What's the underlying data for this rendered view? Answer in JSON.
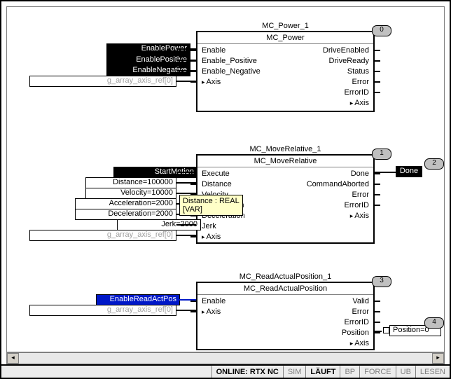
{
  "blocks": {
    "power": {
      "id_tab": "0",
      "instance": "MC_Power_1",
      "type": "MC_Power",
      "left_pins": [
        "Enable",
        "Enable_Positive",
        "Enable_Negative",
        "Axis"
      ],
      "right_pins": [
        "DriveEnabled",
        "DriveReady",
        "Status",
        "Error",
        "ErrorID"
      ],
      "right_axis": "Axis",
      "inputs": [
        {
          "name": "enable-power",
          "text": "EnablePower",
          "inverted": true
        },
        {
          "name": "enable-positive",
          "text": "EnablePositive",
          "inverted": true
        },
        {
          "name": "enable-negative",
          "text": "EnableNegative",
          "inverted": true
        },
        {
          "name": "axis-ref",
          "text": "g_array_axis_ref[0]",
          "dim": true
        }
      ]
    },
    "move": {
      "id_tab": "1",
      "instance": "MC_MoveRelative_1",
      "type": "MC_MoveRelative",
      "left_pins": [
        "Execute",
        "Distance",
        "Velocity",
        "Acceleration",
        "Deceleration",
        "Jerk",
        "Axis"
      ],
      "right_pins": [
        "Done",
        "CommandAborted",
        "Error",
        "ErrorID"
      ],
      "right_axis": "Axis",
      "inputs": [
        {
          "name": "start-motion",
          "text": "StartMotion",
          "inverted": true
        },
        {
          "name": "distance",
          "text": "Distance=100000"
        },
        {
          "name": "velocity",
          "text": "Velocity=10000"
        },
        {
          "name": "acceleration",
          "text": "Acceleration=2000"
        },
        {
          "name": "deceleration",
          "text": "Deceleration=2000"
        },
        {
          "name": "jerk",
          "text": "Jerk=2000"
        },
        {
          "name": "axis-ref",
          "text": "g_array_axis_ref[0]",
          "dim": true
        }
      ],
      "done_output": {
        "id_tab": "2",
        "text": "Done"
      }
    },
    "read": {
      "id_tab": "3",
      "instance": "MC_ReadActualPosition_1",
      "type": "MC_ReadActualPosition",
      "left_pins": [
        "Enable",
        "Axis"
      ],
      "right_pins": [
        "Valid",
        "Error",
        "ErrorID",
        "Position"
      ],
      "right_axis": "Axis",
      "inputs": [
        {
          "name": "enable-read",
          "text": "EnableReadActPos",
          "blue": true
        },
        {
          "name": "axis-ref",
          "text": "g_array_axis_ref[0]",
          "dim": true
        }
      ],
      "position_output": {
        "id_tab": "4",
        "text": "Position=0"
      }
    }
  },
  "tooltip": {
    "line1": "Distance : REAL",
    "line2": "[VAR]"
  },
  "status": {
    "items": [
      {
        "text": "ONLINE: RTX NC",
        "active": true
      },
      {
        "text": "SIM"
      },
      {
        "text": "LÄUFT",
        "active": true
      },
      {
        "text": "BP"
      },
      {
        "text": "FORCE"
      },
      {
        "text": "UB"
      },
      {
        "text": "LESEN"
      }
    ]
  }
}
